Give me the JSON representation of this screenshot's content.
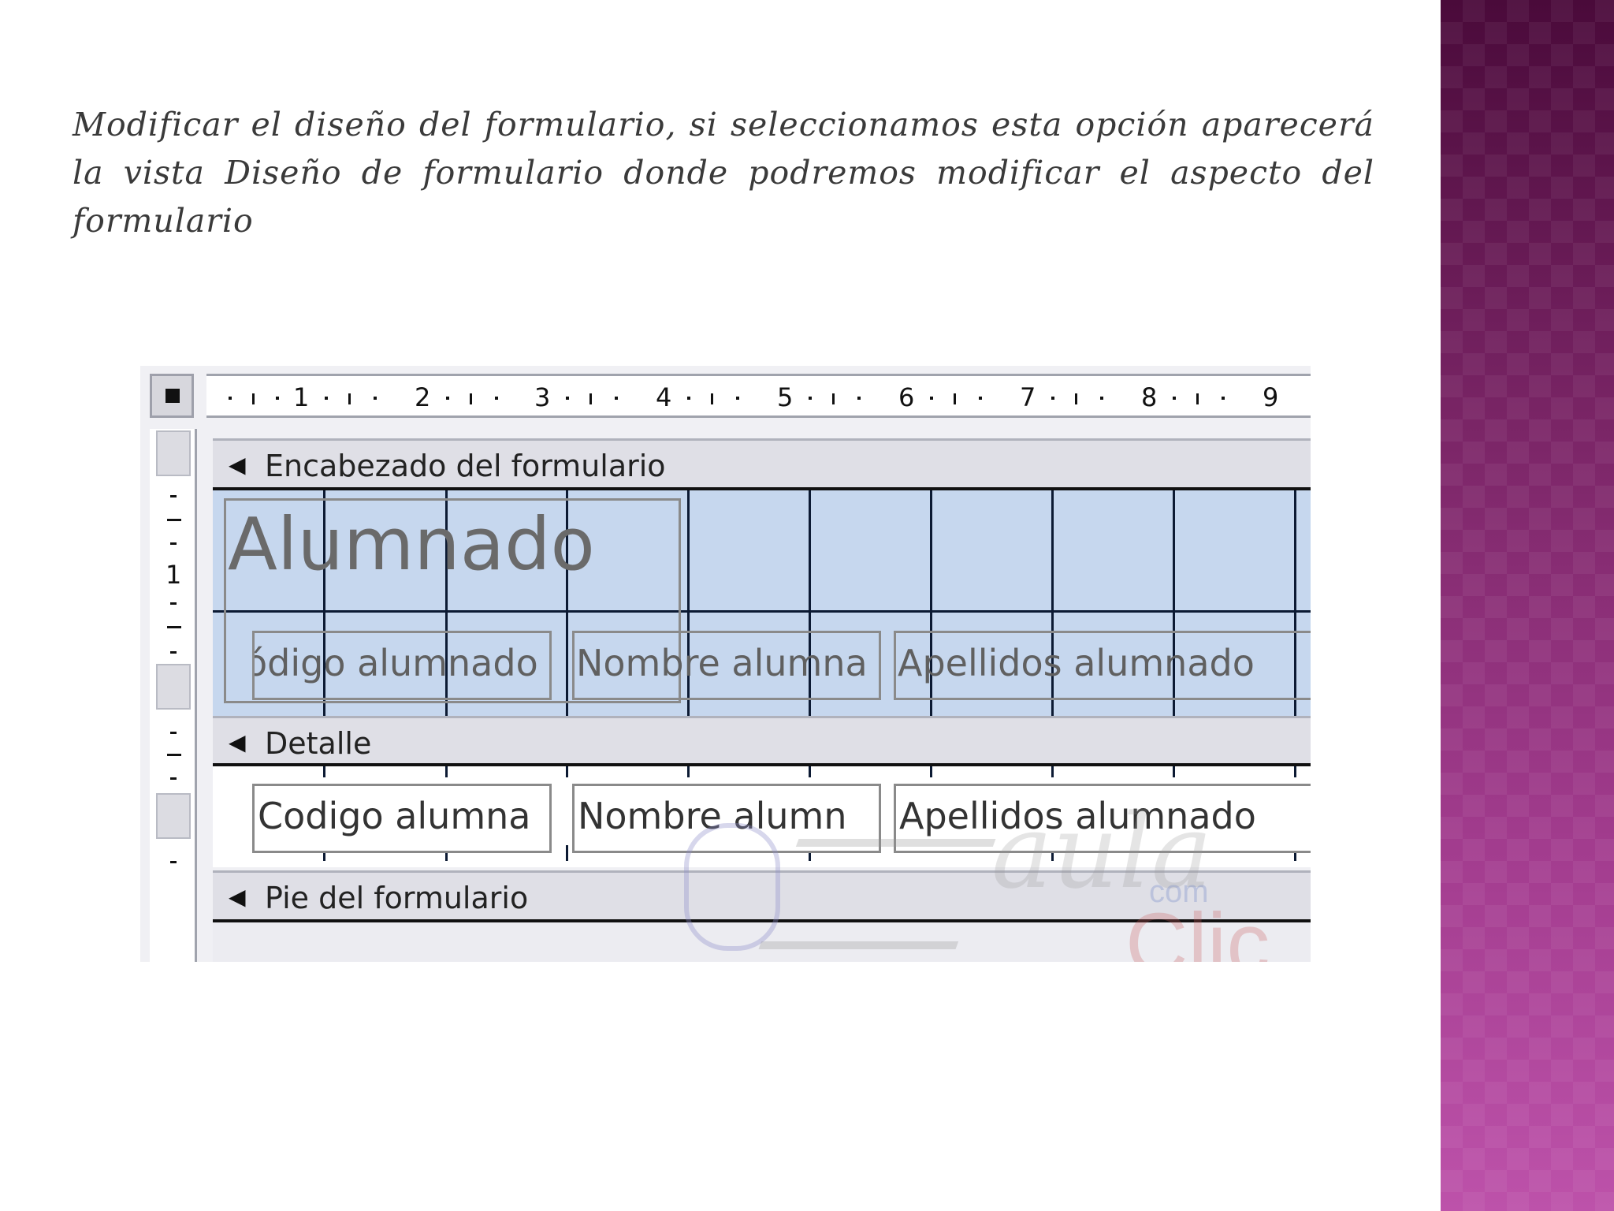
{
  "slide": {
    "text": "Modificar el diseño del formulario, si seleccionamos esta opción aparecerá la vista Diseño de formulario donde podremos modificar el aspecto del formulario"
  },
  "form_designer": {
    "ruler_numbers": [
      "1",
      "2",
      "3",
      "4",
      "5",
      "6",
      "7",
      "8",
      "9"
    ],
    "vertical_ruler_number": "1",
    "sections": {
      "header": {
        "label": "Encabezado del formulario",
        "arrow_icon": "section-arrow-icon"
      },
      "detail": {
        "label": "Detalle",
        "arrow_icon": "section-arrow-icon"
      },
      "footer": {
        "label": "Pie del formulario",
        "arrow_icon": "section-arrow-icon"
      }
    },
    "header_controls": {
      "title": "Alumnado",
      "label_codigo": "ódigo alumnado",
      "label_nombre": "Nombre alumna",
      "label_apellidos": "Apellidos alumnado"
    },
    "detail_controls": {
      "field_codigo": "Codigo alumna",
      "field_nombre": "Nombre alumn",
      "field_apellidos": "Apellidos alumnado"
    },
    "watermark": {
      "word": "aula",
      "com": "com",
      "clic": "Clic"
    }
  }
}
